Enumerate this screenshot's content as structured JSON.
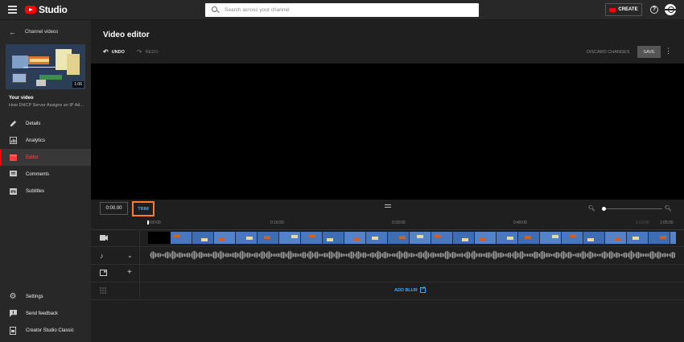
{
  "topbar": {
    "brand": "Studio",
    "search_placeholder": "Search across your channel",
    "create_label": "CREATE",
    "help_symbol": "?"
  },
  "sidebar": {
    "back_label": "Channel videos",
    "thumbnail_duration": "1:06",
    "your_video_label": "Your video",
    "video_title": "How DHCP Server Assigns an IP Ad...",
    "items": [
      {
        "label": "Details",
        "icon": "pencil-icon"
      },
      {
        "label": "Analytics",
        "icon": "analytics-icon"
      },
      {
        "label": "Editor",
        "icon": "editor-icon",
        "active": true
      },
      {
        "label": "Comments",
        "icon": "comments-icon"
      },
      {
        "label": "Subtitles",
        "icon": "subtitles-icon"
      }
    ],
    "bottom_items": [
      {
        "label": "Settings",
        "icon": "gear-icon"
      },
      {
        "label": "Send feedback",
        "icon": "feedback-icon"
      },
      {
        "label": "Creator Studio Classic",
        "icon": "classic-icon"
      }
    ]
  },
  "editor": {
    "title": "Video editor",
    "undo_label": "UNDO",
    "redo_label": "REDO",
    "discard_label": "DISCARD CHANGES",
    "save_label": "SAVE",
    "time_value": "0:00.00",
    "trim_label": "TRIM",
    "zoom_level": 0,
    "ticks": [
      "0:00:00",
      "0:16:50",
      "0:33:00",
      "0:49:00",
      "1:03:00",
      "1:05:00"
    ],
    "add_blur_label": "ADD BLUR"
  },
  "colors": {
    "accent_red": "#ff0000",
    "link_blue": "#3ea6ff",
    "trim_highlight": "#ff7a2d"
  }
}
